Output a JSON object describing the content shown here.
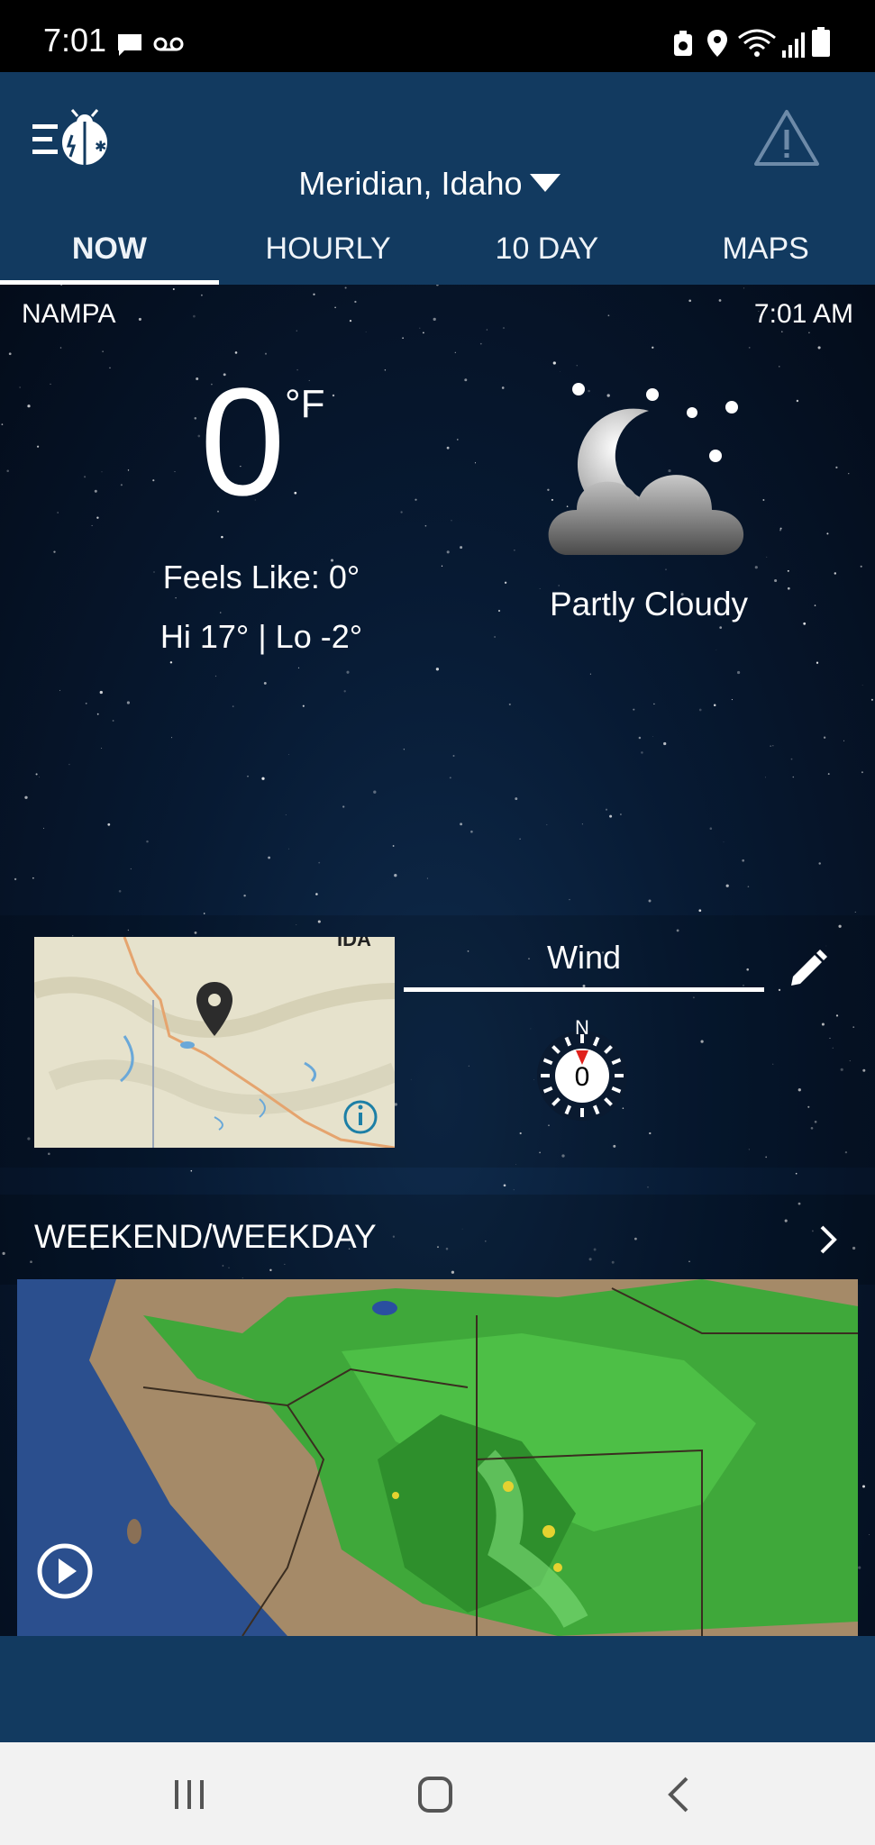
{
  "status_bar": {
    "time": "7:01",
    "icons": [
      "message-icon",
      "voicemail-icon",
      "battery-saver-icon",
      "location-icon",
      "wifi-icon",
      "signal-icon",
      "battery-icon"
    ]
  },
  "header": {
    "location": "Meridian, Idaho",
    "menu_icon": "menu-logo-icon",
    "alert_icon": "warning-icon"
  },
  "tabs": [
    {
      "label": "NOW",
      "active": true
    },
    {
      "label": "HOURLY",
      "active": false
    },
    {
      "label": "10 DAY",
      "active": false
    },
    {
      "label": "MAPS",
      "active": false
    }
  ],
  "current": {
    "station": "NAMPA",
    "time": "7:01 AM",
    "temperature": "0",
    "unit": "°F",
    "feels_like": "Feels Like: 0°",
    "hi_lo": "Hi 17° | Lo -2°",
    "condition": "Partly Cloudy",
    "condition_icon": "partly-cloudy-night-icon"
  },
  "wind": {
    "title": "Wind",
    "direction_label": "N",
    "speed": "0"
  },
  "section": {
    "title": "WEEKEND/WEEKDAY"
  },
  "colors": {
    "header_bg": "#123a60",
    "accent_red": "#e0201b",
    "nav_bg": "#f2f2f2"
  }
}
